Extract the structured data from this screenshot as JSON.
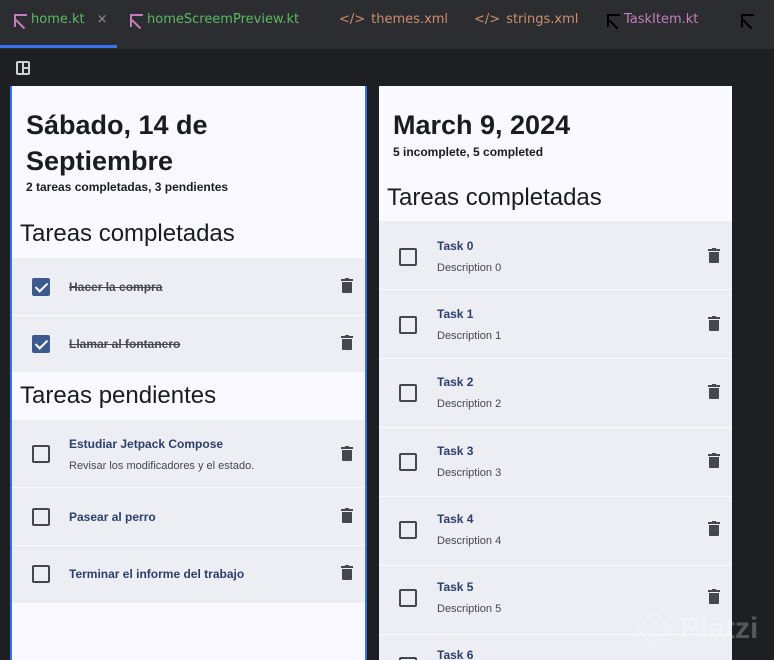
{
  "tabs": [
    {
      "label": "home.kt",
      "type": "kt",
      "active": true
    },
    {
      "label": "homeScreemPreview.kt",
      "type": "kt"
    },
    {
      "label": "themes.xml",
      "type": "xml"
    },
    {
      "label": "strings.xml",
      "type": "xml"
    },
    {
      "label": "TaskItem.kt",
      "type": "kt"
    }
  ],
  "tab_close": "×",
  "xml_glyph": "</>",
  "left_preview": {
    "date_line1": "Sábado, 14 de",
    "date_line2": "Septiembre",
    "summary": "2 tareas completadas, 3 pendientes",
    "completed_header": "Tareas completadas",
    "pending_header": "Tareas pendientes",
    "completed": [
      {
        "title": "Hacer la compra"
      },
      {
        "title": "Llamar al fontanero"
      }
    ],
    "pending": [
      {
        "title": "Estudiar Jetpack Compose",
        "description": "Revisar los modificadores y el estado."
      },
      {
        "title": "Pasear al perro"
      },
      {
        "title": "Terminar el informe del trabajo"
      }
    ]
  },
  "right_preview": {
    "date": "March 9, 2024",
    "summary": "5 incomplete, 5 completed",
    "completed_header": "Tareas completadas",
    "tasks": [
      {
        "title": "Task 0",
        "description": "Description 0"
      },
      {
        "title": "Task 1",
        "description": "Description 1"
      },
      {
        "title": "Task 2",
        "description": "Description 2"
      },
      {
        "title": "Task 3",
        "description": "Description 3"
      },
      {
        "title": "Task 4",
        "description": "Description 4"
      },
      {
        "title": "Task 5",
        "description": "Description 5"
      },
      {
        "title": "Task 6"
      }
    ]
  },
  "watermark": "Platzi",
  "colors": {
    "accent": "#3574f0",
    "checked": "#3d5a8e",
    "card": "#eceef4",
    "surface": "#f9f9ff"
  }
}
